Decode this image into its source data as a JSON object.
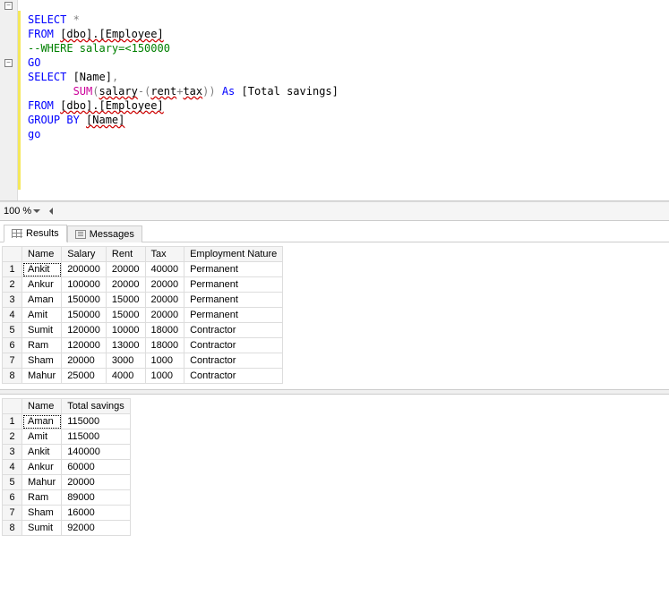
{
  "editor": {
    "lines": [
      {
        "html": "<span class='kw'>SELECT</span> <span class='op'>*</span>"
      },
      {
        "html": "<span class='kw'>FROM</span> <span class='squiggle'>[dbo].[Employee]</span>"
      },
      {
        "html": "<span class='comment'>--WHERE salary=&lt;150000</span>"
      },
      {
        "html": "<span class='kw'>GO</span>"
      },
      {
        "html": "<span class='kw'>SELECT</span> [Name]<span class='op'>,</span>"
      },
      {
        "html": "       <span class='func'>SUM</span><span class='op'>(</span><span class='squiggle'>salary</span><span class='op'>-(</span><span class='squiggle'>rent</span><span class='op'>+</span><span class='squiggle'>tax</span><span class='op'>))</span> <span class='kw'>As</span> [Total savings]"
      },
      {
        "html": "<span class='kw'>FROM</span> <span class='squiggle'>[dbo].[Employee]</span>"
      },
      {
        "html": "<span class='kw'>GROUP BY</span> <span class='squiggle'>[Name]</span>"
      },
      {
        "html": "<span class='kw'>go</span>"
      }
    ],
    "toggles": [
      2,
      66
    ]
  },
  "zoom": "100 %",
  "tabs": {
    "results": "Results",
    "messages": "Messages"
  },
  "grid1": {
    "headers": [
      "Name",
      "Salary",
      "Rent",
      "Tax",
      "Employment Nature"
    ],
    "rows": [
      [
        "Ankit",
        "200000",
        "20000",
        "40000",
        "Permanent"
      ],
      [
        "Ankur",
        "100000",
        "20000",
        "20000",
        "Permanent"
      ],
      [
        "Aman",
        "150000",
        "15000",
        "20000",
        "Permanent"
      ],
      [
        "Amit",
        "150000",
        "15000",
        "20000",
        "Permanent"
      ],
      [
        "Sumit",
        "120000",
        "10000",
        "18000",
        "Contractor"
      ],
      [
        "Ram",
        "120000",
        "13000",
        "18000",
        "Contractor"
      ],
      [
        "Sham",
        "20000",
        "3000",
        "1000",
        "Contractor"
      ],
      [
        "Mahur",
        "25000",
        "4000",
        "1000",
        "Contractor"
      ]
    ]
  },
  "grid2": {
    "headers": [
      "Name",
      "Total savings"
    ],
    "rows": [
      [
        "Aman",
        "115000"
      ],
      [
        "Amit",
        "115000"
      ],
      [
        "Ankit",
        "140000"
      ],
      [
        "Ankur",
        "60000"
      ],
      [
        "Mahur",
        "20000"
      ],
      [
        "Ram",
        "89000"
      ],
      [
        "Sham",
        "16000"
      ],
      [
        "Sumit",
        "92000"
      ]
    ]
  }
}
